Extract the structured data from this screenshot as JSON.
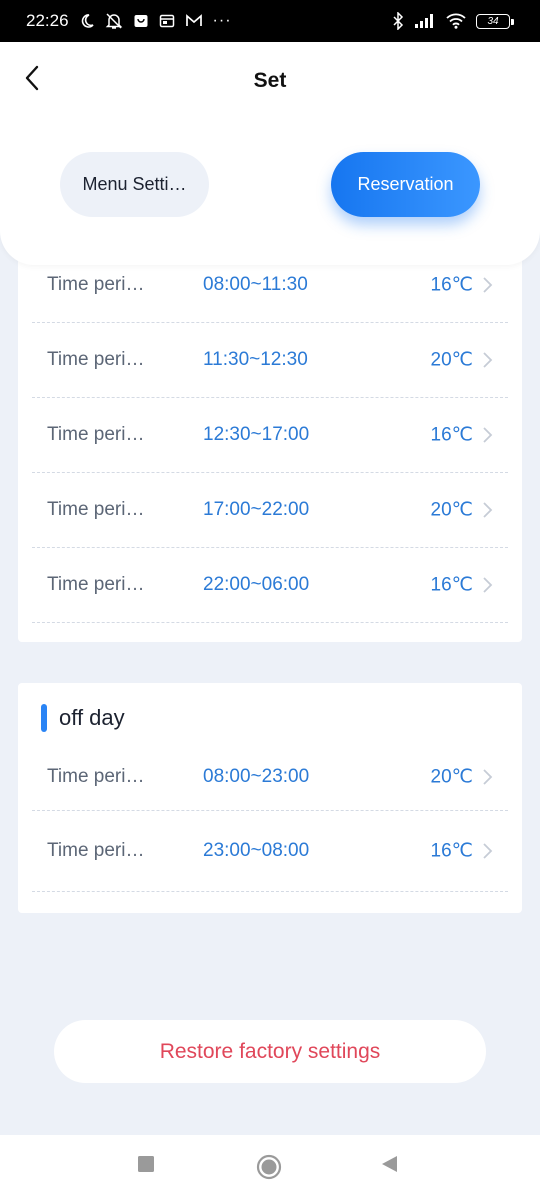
{
  "status_bar": {
    "time": "22:26",
    "battery": "34",
    "icons": [
      "moon-icon",
      "mute-icon",
      "shopping-icon",
      "calendar-icon",
      "mail-icon",
      "more-icon",
      "bluetooth-icon",
      "signal-icon",
      "wifi-icon",
      "battery-icon"
    ],
    "more": "···"
  },
  "header": {
    "title": "Set",
    "back_icon": "chevron-left-icon"
  },
  "tabs": {
    "menu_label": "Menu Setti…",
    "reservation_label": "Reservation",
    "active": "Reservation",
    "active_color": "#1f80f8"
  },
  "workday_periods": [
    {
      "label": "Time peri…",
      "range": "08:00~11:30",
      "temp": "16℃"
    },
    {
      "label": "Time peri…",
      "range": "11:30~12:30",
      "temp": "20℃"
    },
    {
      "label": "Time peri…",
      "range": "12:30~17:00",
      "temp": "16℃"
    },
    {
      "label": "Time peri…",
      "range": "17:00~22:00",
      "temp": "20℃"
    },
    {
      "label": "Time peri…",
      "range": "22:00~06:00",
      "temp": "16℃"
    }
  ],
  "off_day": {
    "title": "off day",
    "periods": [
      {
        "label": "Time peri…",
        "range": "08:00~23:00",
        "temp": "20℃"
      },
      {
        "label": "Time peri…",
        "range": "23:00~08:00",
        "temp": "16℃"
      }
    ]
  },
  "restore": {
    "label": "Restore factory settings",
    "color": "#e0475a"
  },
  "colors": {
    "accent": "#2b7ad6",
    "background": "#edf1f8"
  }
}
